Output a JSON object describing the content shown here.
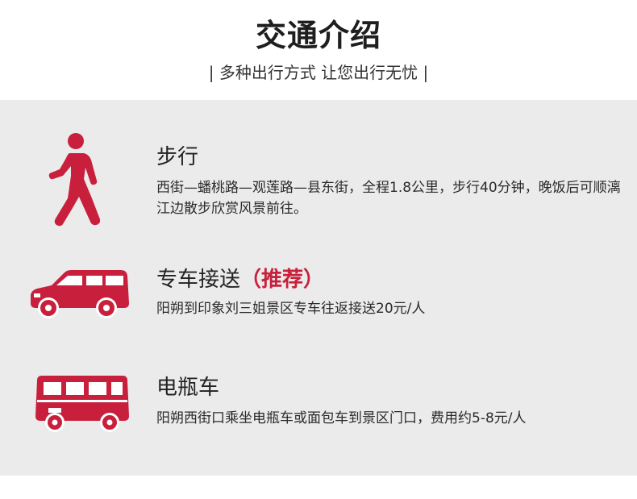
{
  "header": {
    "title": "交通介绍",
    "subtitle": "| 多种出行方式 让您出行无忧 |"
  },
  "colors": {
    "accent": "#c8203c",
    "panel_bg": "#ebebeb"
  },
  "items": [
    {
      "icon": "walking-person-icon",
      "title": "步行",
      "desc": "西街—蟠桃路—观莲路—县东街，全程1.8公里，步行40分钟，晚饭后可顺漓江边散步欣赏风景前往。"
    },
    {
      "icon": "van-icon",
      "title": "专车接送",
      "highlight": "（推荐）",
      "desc": "阳朔到印象刘三姐景区专车往返接送20元/人"
    },
    {
      "icon": "bus-icon",
      "title": "电瓶车",
      "desc": "阳朔西街口乘坐电瓶车或面包车到景区门口，费用约5-8元/人"
    }
  ]
}
